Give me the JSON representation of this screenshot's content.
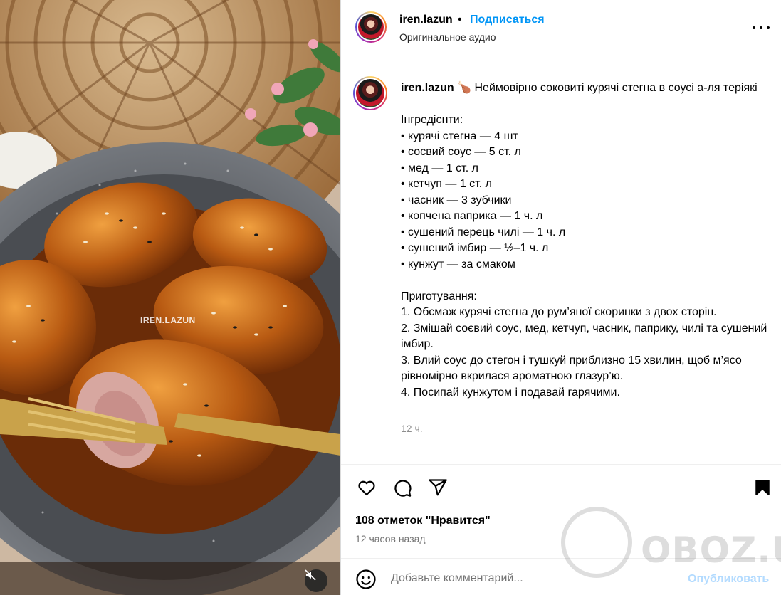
{
  "media": {
    "watermark": "IREN.LAZUN"
  },
  "header": {
    "username": "iren.lazun",
    "dot": "•",
    "follow_label": "Подписаться",
    "audio_label": "Оригинальное аудио"
  },
  "caption": {
    "username": "iren.lazun",
    "text": " 🍗 Неймовірно соковиті курячі стегна в соусі а-ля теріякі\n\nІнгредієнти:\n• курячі стегна — 4 шт\n• соєвий соус — 5 ст. л\n• мед — 1 ст. л\n• кетчуп — 1 ст. л\n• часник — 3 зубчики\n• копчена паприка — 1 ч. л\n• сушений перець чилі — 1 ч. л\n• сушений імбир — ½–1 ч. л\n• кунжут — за смаком\n\nПриготування:\n1. Обсмаж курячі стегна до рум’яної скоринки з двох сторін.\n2. Змішай соєвий соус, мед, кетчуп, часник, паприку, чилі та сушений імбир.\n3. Влий соус до стегон і тушкуй приблизно 15 хвилин, щоб м’ясо рівномірно вкрилася ароматною глазур’ю.\n4. Посипай кунжутом і подавай гарячими.",
    "time": "12 ч."
  },
  "actions": {
    "icons": [
      "heart-icon",
      "comment-icon",
      "share-icon",
      "bookmark-icon"
    ],
    "likes": "108 отметок \"Нравится\"",
    "posted": "12 часов назад"
  },
  "comment": {
    "placeholder": "Добавьте комментарий...",
    "publish_label": "Опубликовать"
  },
  "overlay": {
    "brand_watermark": "OBOZ.UA"
  },
  "colors": {
    "link_blue": "#0095f6",
    "publish_disabled": "#b3dbff",
    "muted_text": "#737373"
  }
}
